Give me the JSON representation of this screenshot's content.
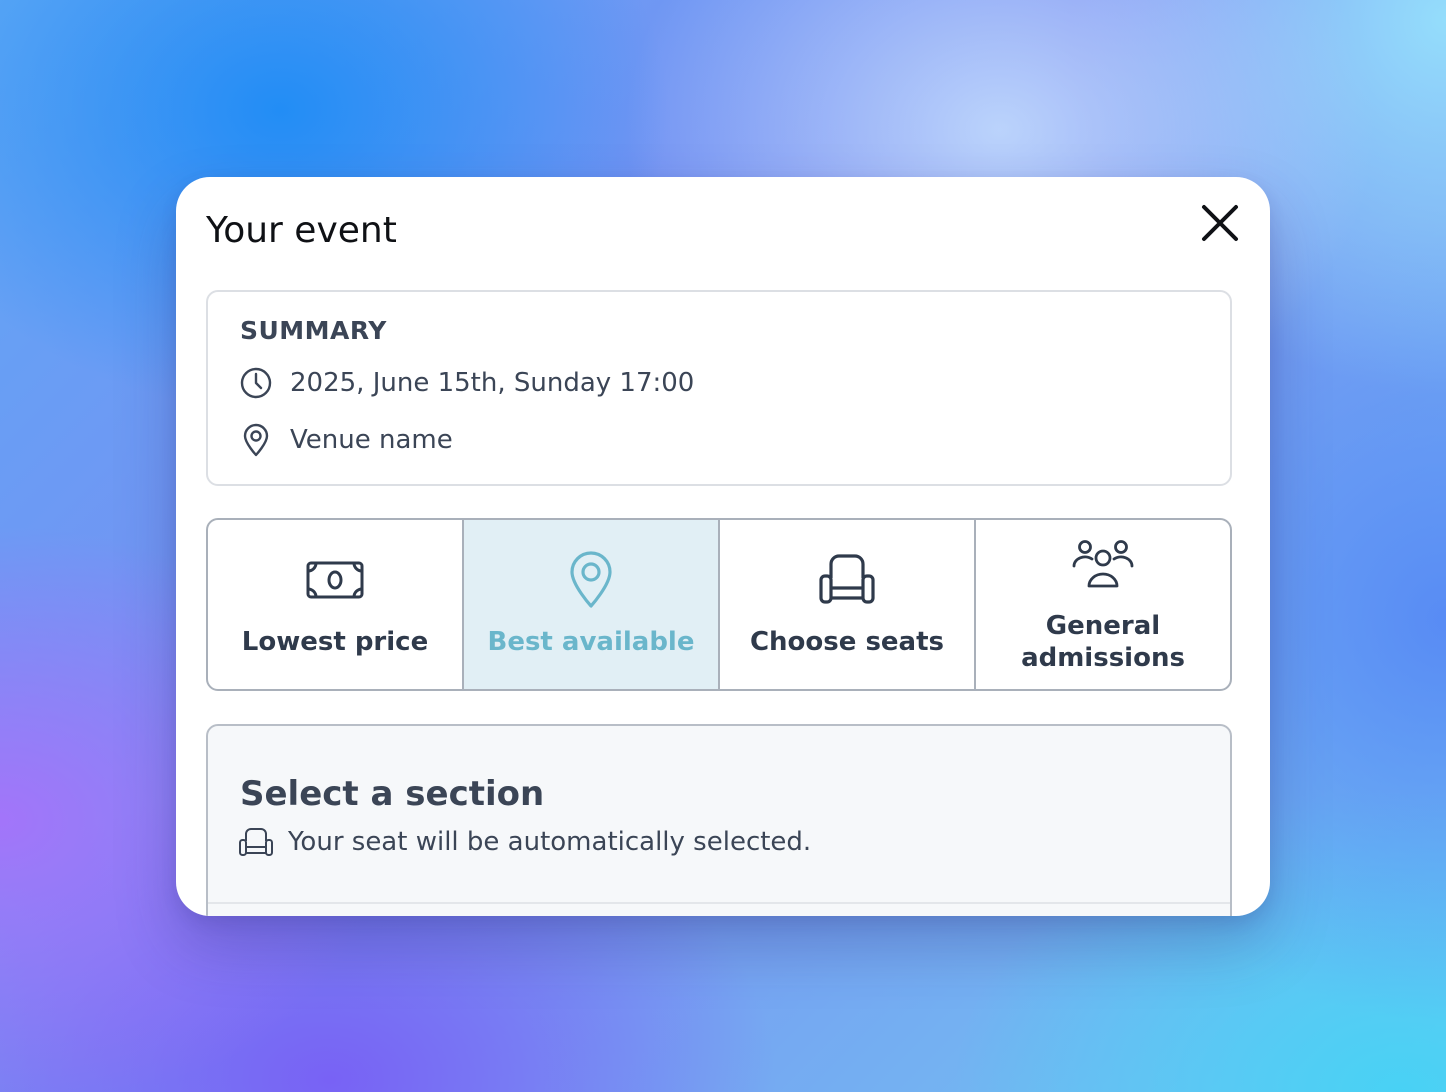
{
  "modal": {
    "title": "Your event",
    "close_icon": "close-icon"
  },
  "summary": {
    "heading": "SUMMARY",
    "date_icon": "clock-icon",
    "date": "2025, June 15th, Sunday 17:00",
    "venue_icon": "location-pin-icon",
    "venue": "Venue name"
  },
  "options": [
    {
      "label": "Lowest price",
      "icon": "banknote-icon",
      "active": false
    },
    {
      "label": "Best available",
      "icon": "location-pin-icon",
      "active": true
    },
    {
      "label": "Choose seats",
      "icon": "armchair-icon",
      "active": false
    },
    {
      "label": "General admissions",
      "icon": "group-icon",
      "active": false
    }
  ],
  "section": {
    "title": "Select a section",
    "subtitle_icon": "armchair-icon",
    "subtitle": "Your seat will be automatically selected."
  },
  "colors": {
    "accent": "#6ab6cb",
    "active_background": "#e1eff5",
    "text": "#3b4556"
  }
}
